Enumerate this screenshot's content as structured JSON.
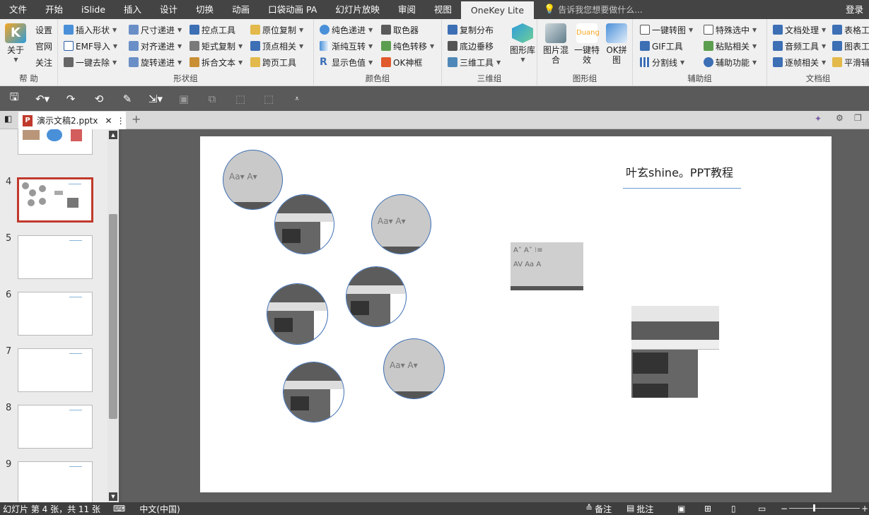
{
  "menu": {
    "tabs": [
      "文件",
      "开始",
      "iSlide",
      "插入",
      "设计",
      "切换",
      "动画",
      "口袋动画 PA",
      "幻灯片放映",
      "审阅",
      "视图",
      "OneKey Lite"
    ],
    "tell_me": "告诉我您想要做什么...",
    "login": "登录"
  },
  "ribbon": {
    "help": {
      "label": "帮 助",
      "about": "关于",
      "settings": "设置",
      "website": "官网",
      "follow": "关注"
    },
    "shape": {
      "label": "形状组",
      "insert_shape": "插入形状",
      "emf_import": "EMF导入",
      "one_remove": "一键去除",
      "size_step": "尺寸递进",
      "align_step": "对齐递进",
      "rotate_step": "旋转递进",
      "control_tool": "控点工具",
      "matrix_copy": "矩式复制",
      "split_text": "拆合文本",
      "original_copy": "原位复制",
      "vertex_related": "顶点相关",
      "cross_page": "跨页工具"
    },
    "color": {
      "label": "颜色组",
      "solid_step": "纯色递进",
      "gradient_swap": "渐纯互转",
      "show_color": "显示色值",
      "picker": "取色器",
      "solid_transfer": "纯色转移",
      "ok_frame": "OK神框"
    },
    "three_d": {
      "label": "三维组",
      "copy_dist": "复制分布",
      "bottom_stack": "底边垂移",
      "three_d_tool": "三维工具",
      "shape_lib": "图形库"
    },
    "graphic": {
      "label": "图形组",
      "img_mix": "图片混合",
      "one_effect": "一键特效",
      "ok_puzzle": "OK拼图"
    },
    "aux": {
      "label": "辅助组",
      "one_screenshot": "一键转图",
      "gif_tool": "GIF工具",
      "divider": "分割线",
      "special_select": "特殊选中",
      "paste_related": "粘贴相关",
      "aux_func": "辅助功能"
    },
    "doc": {
      "label": "文档组",
      "doc_process": "文档处理",
      "audio_tool": "音频工具",
      "frame_related": "逐帧相关",
      "table_tool": "表格工",
      "chart_tool": "图表工",
      "smooth": "平滑辅"
    }
  },
  "doc": {
    "filename": "演示文稿2.pptx"
  },
  "thumbs": [
    "4",
    "5",
    "6",
    "7",
    "8",
    "9"
  ],
  "slide": {
    "title": "叶玄shine。PPT教程"
  },
  "status": {
    "slide_info": "幻灯片 第 4 张，共 11 张",
    "lang": "中文(中国)",
    "notes": "备注",
    "comments": "批注"
  }
}
